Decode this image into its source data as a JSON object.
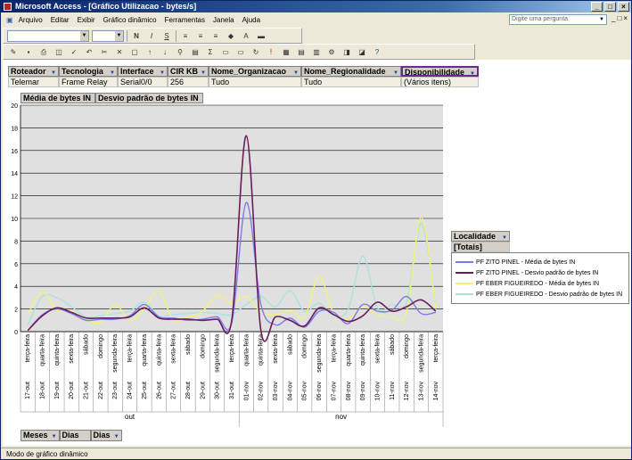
{
  "window": {
    "title": "Microsoft Access - [Gráfico Utilizacao - bytes/s]",
    "controls": [
      "_",
      "□",
      "×"
    ]
  },
  "menu": {
    "items": [
      "Arquivo",
      "Editar",
      "Exibir",
      "Gráfico dinâmico",
      "Ferramentas",
      "Janela",
      "Ajuda"
    ],
    "help_placeholder": "Digite uma pergunta"
  },
  "filters": {
    "fields": [
      {
        "name": "Roteador",
        "value": "Telemar"
      },
      {
        "name": "Tecnologia",
        "value": "Frame Relay"
      },
      {
        "name": "Interface",
        "value": "Serial0/0"
      },
      {
        "name": "CIR KB",
        "value": "256"
      },
      {
        "name": "Nome_Organizacao",
        "value": "Tudo"
      },
      {
        "name": "Nome_Regionalidade",
        "value": "Tudo"
      },
      {
        "name": "Disponibilidade",
        "value": "(Vários itens)"
      }
    ]
  },
  "data_fields": [
    "Média de bytes IN",
    "Desvio padrão de bytes IN"
  ],
  "series_field": {
    "name": "Localidade",
    "total": "[Totais]"
  },
  "category_fields": [
    "Meses",
    "Dias",
    "Dias"
  ],
  "status": "Modo de gráfico dinâmico",
  "colors": {
    "s1": "#7b7be8",
    "s2": "#6a1d5c",
    "s3": "#f2f27a",
    "s4": "#a8e4dc"
  },
  "chart_data": {
    "type": "line",
    "title": "",
    "xlabel": "",
    "ylabel": "",
    "ylim": [
      0,
      20
    ],
    "yticks": [
      0,
      2,
      4,
      6,
      8,
      10,
      12,
      14,
      16,
      18,
      20
    ],
    "grid": true,
    "legend_placement": "right",
    "months": [
      {
        "label": "out",
        "from": 0,
        "to": 14
      },
      {
        "label": "nov",
        "from": 15,
        "to": 28
      }
    ],
    "categories": [
      [
        "17-out",
        "terça-feira"
      ],
      [
        "18-out",
        "quarta-feira"
      ],
      [
        "19-out",
        "quinta-feira"
      ],
      [
        "20-out",
        "sexta-feira"
      ],
      [
        "21-out",
        "sábado"
      ],
      [
        "22-out",
        "domingo"
      ],
      [
        "23-out",
        "segunda-feira"
      ],
      [
        "24-out",
        "terça-feira"
      ],
      [
        "25-out",
        "quarta-feira"
      ],
      [
        "26-out",
        "quinta-feira"
      ],
      [
        "27-out",
        "sexta-feira"
      ],
      [
        "28-out",
        "sábado"
      ],
      [
        "29-out",
        "domingo"
      ],
      [
        "30-out",
        "segunda-feira"
      ],
      [
        "31-out",
        "terça-feira"
      ],
      [
        "01-nov",
        "quarta-feira"
      ],
      [
        "02-nov",
        "quinta-feira"
      ],
      [
        "03-nov",
        "sexta-feira"
      ],
      [
        "04-nov",
        "sábado"
      ],
      [
        "05-nov",
        "domingo"
      ],
      [
        "06-nov",
        "segunda-feira"
      ],
      [
        "07-nov",
        "terça-feira"
      ],
      [
        "08-nov",
        "quarta-feira"
      ],
      [
        "09-nov",
        "quinta-feira"
      ],
      [
        "10-nov",
        "sexta-feira"
      ],
      [
        "11-nov",
        "sábado"
      ],
      [
        "12-nov",
        "domingo"
      ],
      [
        "13-nov",
        "segunda-feira"
      ],
      [
        "14-nov",
        "terça-feira"
      ]
    ],
    "series": [
      {
        "name": "PF ZITO PINEL - Média de bytes IN",
        "color_key": "s1",
        "values": [
          0.1,
          1.5,
          2.0,
          1.6,
          1.0,
          1.1,
          1.1,
          1.4,
          2.4,
          1.3,
          1.2,
          1.0,
          1.1,
          1.3,
          0.8,
          11.4,
          2.4,
          0.6,
          1.2,
          0.4,
          1.8,
          1.7,
          0.7,
          2.4,
          1.8,
          1.9,
          3.1,
          1.6,
          1.7
        ]
      },
      {
        "name": "PF ZITO PINEL - Desvio padrão de bytes IN",
        "color_key": "s2",
        "values": [
          0.1,
          1.4,
          2.1,
          1.7,
          1.2,
          1.2,
          1.2,
          1.3,
          2.1,
          1.2,
          1.1,
          1.1,
          1.0,
          1.1,
          1.0,
          17.3,
          0.1,
          1.3,
          1.0,
          0.5,
          2.1,
          1.5,
          0.9,
          1.4,
          2.6,
          1.8,
          2.2,
          2.8,
          1.8
        ]
      },
      {
        "name": "PF EBER FIGUEIREDO - Média de bytes IN",
        "color_key": "s3",
        "values": [
          1.5,
          3.5,
          1.9,
          1.8,
          1.1,
          0.8,
          2.4,
          1.0,
          2.0,
          3.6,
          1.0,
          1.3,
          1.8,
          3.2,
          2.5,
          3.1,
          1.7,
          1.5,
          1.9,
          1.3,
          4.9,
          1.6,
          1.1,
          2.2,
          1.5,
          1.3,
          1.7,
          10.1,
          2.0
        ]
      },
      {
        "name": "PF EBER FIGUEIREDO - Desvio padrão de bytes IN",
        "color_key": "s4",
        "values": [
          0.6,
          3.1,
          3.0,
          2.2,
          1.3,
          1.4,
          1.6,
          1.8,
          2.6,
          1.4,
          1.5,
          1.6,
          1.7,
          1.6,
          1.5,
          2.4,
          3.1,
          2.2,
          3.6,
          1.8,
          2.5,
          1.4,
          2.0,
          6.7,
          2.1,
          2.4,
          2.6,
          9.6,
          2.3
        ]
      }
    ]
  }
}
